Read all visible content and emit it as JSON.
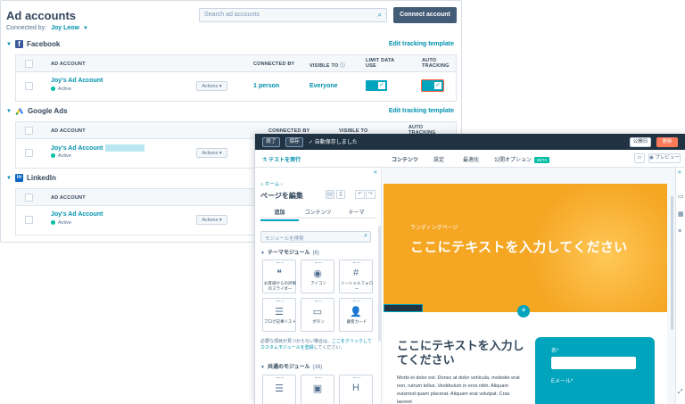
{
  "ads": {
    "title": "Ad accounts",
    "connected_by_label": "Connected by:",
    "connected_by_user": "Joy Leow",
    "search_placeholder": "Search ad accounts",
    "connect_button": "Connect account",
    "sections": [
      {
        "name": "Facebook",
        "edit_link": "Edit tracking template",
        "columns": [
          "AD ACCOUNT",
          "CONNECTED BY",
          "VISIBLE TO",
          "LIMIT DATA USE",
          "AUTO TRACKING"
        ],
        "row": {
          "name": "Joy's Ad Account",
          "status": "Active",
          "actions": "Actions",
          "connected_by": "1 person",
          "visible_to": "Everyone"
        }
      },
      {
        "name": "Google Ads",
        "edit_link": "Edit tracking template",
        "columns": [
          "AD ACCOUNT",
          "CONNECTED BY",
          "VISIBLE TO",
          "AUTO TRACKING"
        ],
        "row": {
          "name": "Joy's Ad Account",
          "status": "Active",
          "actions": "Actions"
        }
      },
      {
        "name": "LinkedIn",
        "columns": [
          "AD ACCOUNT"
        ],
        "row": {
          "name": "Joy's Ad Account",
          "status": "Active",
          "actions": "Actions"
        }
      }
    ]
  },
  "editor": {
    "topbar": {
      "exit": "終了",
      "save": "保存",
      "autosaved": "自動保存しました",
      "publish": "公開日",
      "update": "更新"
    },
    "tabs": {
      "run_test": "テストを実行",
      "content": "コンテンツ",
      "settings": "設定",
      "optimize": "最適化",
      "publish_options": "公開オプション",
      "beta": "BETA",
      "preview": "プレビュー"
    },
    "sidebar": {
      "breadcrumb": "ホーム",
      "title": "ページを編集",
      "tabs": [
        "追加",
        "コンテンツ",
        "テーマ"
      ],
      "search_placeholder": "モジュールを検索",
      "theme_modules_label": "テーマモジュール",
      "theme_modules_count": "(6)",
      "theme_modules": [
        {
          "label": "お客様からの評価のスライダー",
          "icon": "quote-icon"
        },
        {
          "label": "アイコン",
          "icon": "circle-icon"
        },
        {
          "label": "ソーシャルフォロー",
          "icon": "hashtag-icon"
        },
        {
          "label": "ブログ記事リスト",
          "icon": "list-icon"
        },
        {
          "label": "ボタン",
          "icon": "cursor-icon"
        },
        {
          "label": "顧客カード",
          "icon": "person-icon"
        }
      ],
      "help_prefix": "必要な項目が見つからない場合は、",
      "help_link": "ここをクリックしてカスタムモジュールを登録",
      "help_suffix": "してください。",
      "common_modules_label": "共通のモジュール",
      "common_modules_count": "(16)"
    },
    "canvas": {
      "hero_eyebrow": "ランディングページ",
      "hero_title": "ここにテキストを入力してください",
      "content_title": "ここにテキストを入力してください",
      "content_body": "Morbi et dolor est. Donec at dolor vehicula, molestie erat non, rutrum tellus. Vestibulum in eros nibh. Aliquam euismod quam placerat. Aliquam erat volutpat. Cras laoreet",
      "form_label_name": "名*",
      "form_label_email": "Eメール*"
    }
  }
}
